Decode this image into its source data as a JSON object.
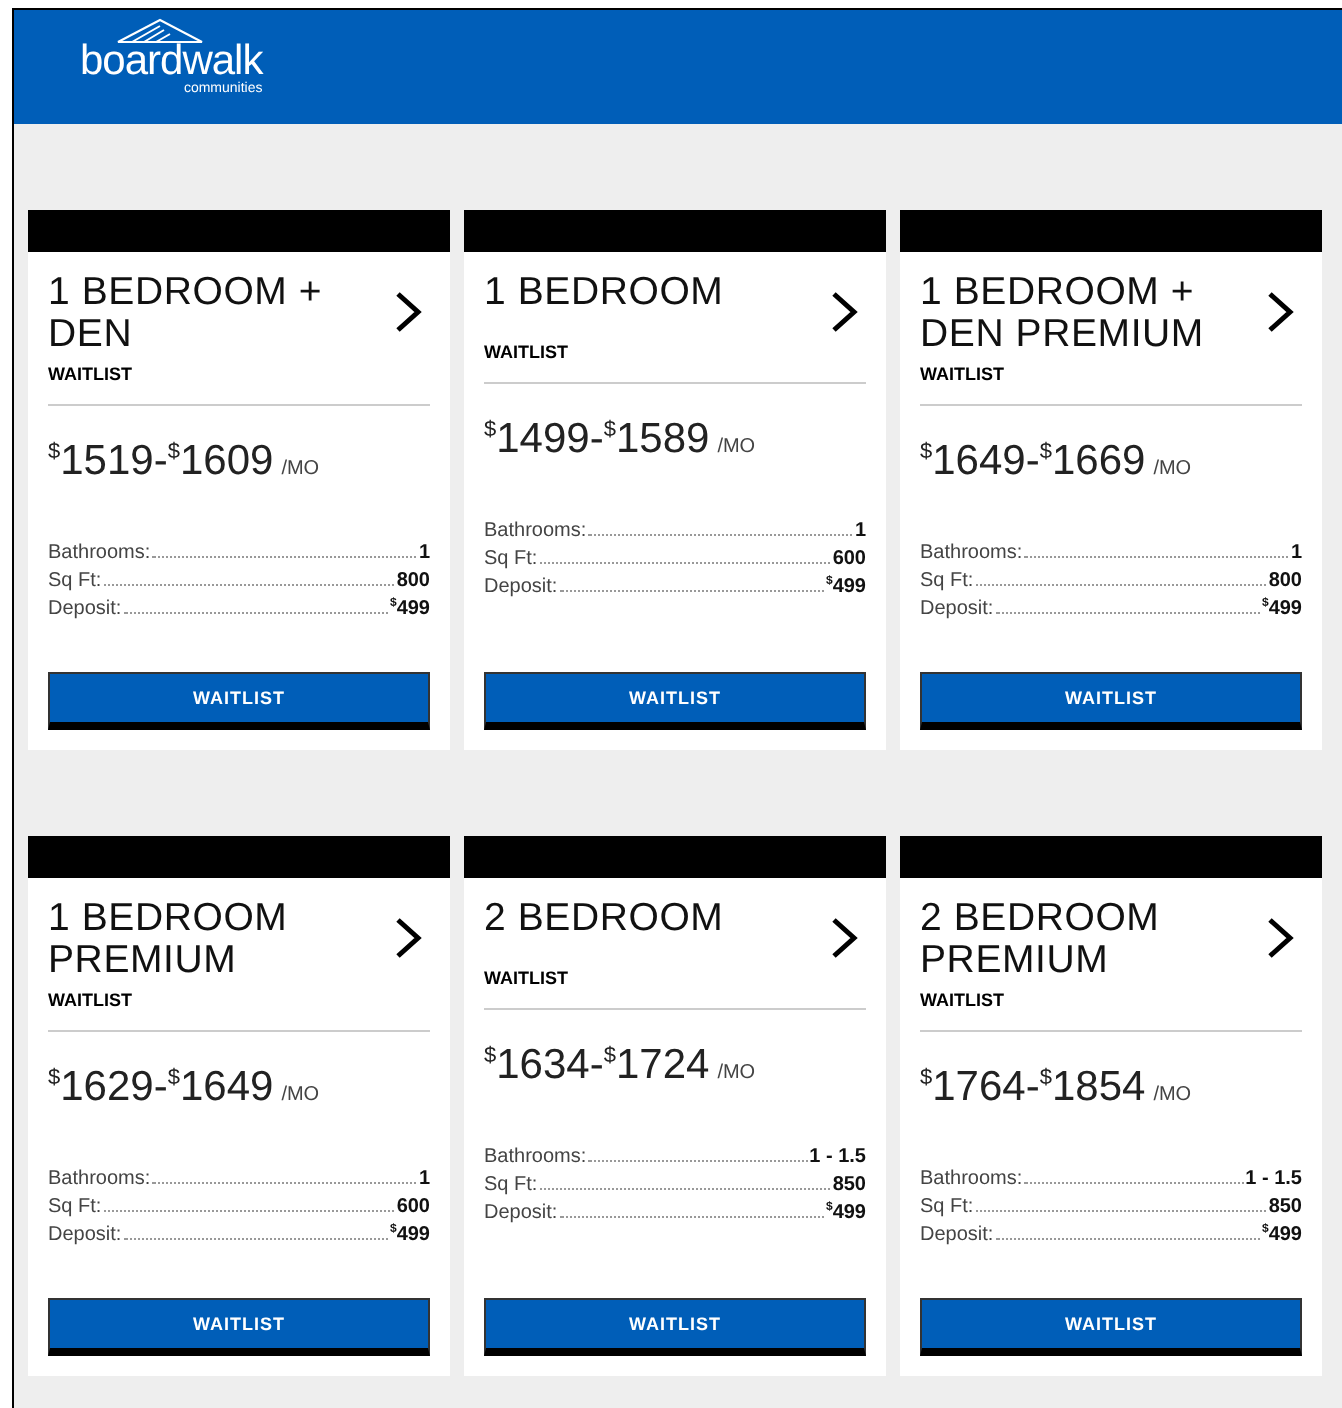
{
  "header": {
    "logo": {
      "name": "boardwalk",
      "tagline": "communities"
    }
  },
  "cards": [
    {
      "title": "1 BEDROOM + DEN",
      "status": "WAITLIST",
      "price": [
        {
          "kind": "sup",
          "text": "$"
        },
        {
          "kind": "num",
          "text": "1519-"
        },
        {
          "kind": "sup",
          "text": "$"
        },
        {
          "kind": "num",
          "text": "1609"
        }
      ],
      "per": "/MO",
      "details": [
        {
          "label": "Bathrooms:",
          "value": [
            {
              "kind": "num",
              "text": "1"
            }
          ]
        },
        {
          "label": "Sq Ft:",
          "value": [
            {
              "kind": "num",
              "text": "800"
            }
          ]
        },
        {
          "label": "Deposit:",
          "value": [
            {
              "kind": "sup",
              "text": "$"
            },
            {
              "kind": "num",
              "text": "499"
            }
          ]
        }
      ],
      "button": "WAITLIST"
    },
    {
      "title": "1 BEDROOM",
      "status": "WAITLIST",
      "price": [
        {
          "kind": "sup",
          "text": "$"
        },
        {
          "kind": "num",
          "text": "1499-"
        },
        {
          "kind": "sup",
          "text": "$"
        },
        {
          "kind": "num",
          "text": "1589"
        }
      ],
      "per": "/MO",
      "details": [
        {
          "label": "Bathrooms:",
          "value": [
            {
              "kind": "num",
              "text": "1"
            }
          ]
        },
        {
          "label": "Sq Ft:",
          "value": [
            {
              "kind": "num",
              "text": "600"
            }
          ]
        },
        {
          "label": "Deposit:",
          "value": [
            {
              "kind": "sup",
              "text": "$"
            },
            {
              "kind": "num",
              "text": "499"
            }
          ]
        }
      ],
      "button": "WAITLIST"
    },
    {
      "title": "1 BEDROOM + DEN PREMIUM",
      "status": "WAITLIST",
      "price": [
        {
          "kind": "sup",
          "text": "$"
        },
        {
          "kind": "num",
          "text": "1649-"
        },
        {
          "kind": "sup",
          "text": "$"
        },
        {
          "kind": "num",
          "text": "1669"
        }
      ],
      "per": "/MO",
      "details": [
        {
          "label": "Bathrooms:",
          "value": [
            {
              "kind": "num",
              "text": "1"
            }
          ]
        },
        {
          "label": "Sq Ft:",
          "value": [
            {
              "kind": "num",
              "text": "800"
            }
          ]
        },
        {
          "label": "Deposit:",
          "value": [
            {
              "kind": "sup",
              "text": "$"
            },
            {
              "kind": "num",
              "text": "499"
            }
          ]
        }
      ],
      "button": "WAITLIST"
    },
    {
      "title": "1 BEDROOM PREMIUM",
      "status": "WAITLIST",
      "price": [
        {
          "kind": "sup",
          "text": "$"
        },
        {
          "kind": "num",
          "text": "1629-"
        },
        {
          "kind": "sup",
          "text": "$"
        },
        {
          "kind": "num",
          "text": "1649"
        }
      ],
      "per": "/MO",
      "details": [
        {
          "label": "Bathrooms:",
          "value": [
            {
              "kind": "num",
              "text": "1"
            }
          ]
        },
        {
          "label": "Sq Ft:",
          "value": [
            {
              "kind": "num",
              "text": "600"
            }
          ]
        },
        {
          "label": "Deposit:",
          "value": [
            {
              "kind": "sup",
              "text": "$"
            },
            {
              "kind": "num",
              "text": "499"
            }
          ]
        }
      ],
      "button": "WAITLIST"
    },
    {
      "title": "2 BEDROOM",
      "status": "WAITLIST",
      "price": [
        {
          "kind": "sup",
          "text": "$"
        },
        {
          "kind": "num",
          "text": "1634-"
        },
        {
          "kind": "sup",
          "text": "$"
        },
        {
          "kind": "num",
          "text": "1724"
        }
      ],
      "per": "/MO",
      "details": [
        {
          "label": "Bathrooms:",
          "value": [
            {
              "kind": "num",
              "text": "1 - 1.5"
            }
          ]
        },
        {
          "label": "Sq Ft:",
          "value": [
            {
              "kind": "num",
              "text": "850"
            }
          ]
        },
        {
          "label": "Deposit:",
          "value": [
            {
              "kind": "sup",
              "text": "$"
            },
            {
              "kind": "num",
              "text": "499"
            }
          ]
        }
      ],
      "button": "WAITLIST"
    },
    {
      "title": "2 BEDROOM PREMIUM",
      "status": "WAITLIST",
      "price": [
        {
          "kind": "sup",
          "text": "$"
        },
        {
          "kind": "num",
          "text": "1764-"
        },
        {
          "kind": "sup",
          "text": "$"
        },
        {
          "kind": "num",
          "text": "1854"
        }
      ],
      "per": "/MO",
      "details": [
        {
          "label": "Bathrooms:",
          "value": [
            {
              "kind": "num",
              "text": "1 - 1.5"
            }
          ]
        },
        {
          "label": "Sq Ft:",
          "value": [
            {
              "kind": "num",
              "text": "850"
            }
          ]
        },
        {
          "label": "Deposit:",
          "value": [
            {
              "kind": "sup",
              "text": "$"
            },
            {
              "kind": "num",
              "text": "499"
            }
          ]
        }
      ],
      "button": "WAITLIST"
    }
  ]
}
